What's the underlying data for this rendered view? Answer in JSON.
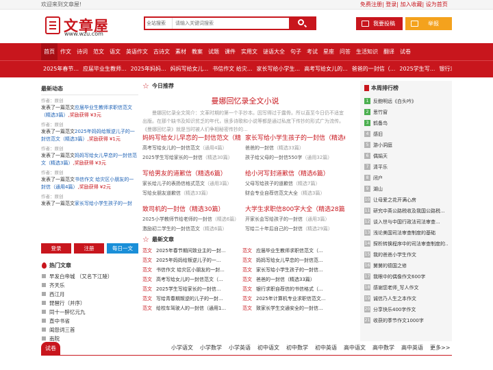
{
  "topbar": {
    "welcome": "欢迎来到文章屋!",
    "links": "免费注册| 登录| 加入收藏| 设为首页"
  },
  "logo": {
    "name": "文章屋",
    "url": "www.wzu.com"
  },
  "search": {
    "scope": "全站搜索",
    "placeholder": "请输入关键词搜索"
  },
  "header_buttons": {
    "submit": "我要投稿",
    "report": "举报"
  },
  "nav": [
    "首页",
    "作文",
    "诗词",
    "范文",
    "语文",
    "英语作文",
    "古诗文",
    "素材",
    "教案",
    "试题",
    "课件",
    "实用文",
    "谜语大全",
    "句子",
    "考试",
    "星座",
    "问答",
    "生活知识",
    "翻译",
    "试卷"
  ],
  "subnav": [
    "2025年春节...",
    "应届毕业生教师...",
    "2025年妈妈...",
    "妈妈写给女儿...",
    "书信作文 给灾...",
    "家长写给小学生...",
    "高考写给女儿的...",
    "爸爸的一封信（...",
    "2025学生写...",
    "银行求职"
  ],
  "left": {
    "title": "最新动态",
    "items": [
      {
        "who": "作者：原创",
        "pre": "发表了一篇范文",
        "link": "应届毕业生教师求职信范文（精选3篇）",
        "reward": ",奖励获得 ¥3元"
      },
      {
        "who": "作者：原创",
        "pre": "发表了一篇范文",
        "link": "2025年妈妈给叛逆儿子的一封信范文（精选3篇）",
        "reward": ",奖励获得 ¥1元"
      },
      {
        "who": "作者：原创",
        "pre": "发表了一篇范文",
        "link": "妈妈写给女儿早恋的一封信范文（精选3篇）",
        "reward": ",奖励获得 ¥3元"
      },
      {
        "who": "作者：原创",
        "pre": "发表了一篇范文",
        "link": "书信作文 给灾区小朋友的一封信（通用4篇）",
        "reward": ",奖励获得 ¥2元"
      },
      {
        "who": "作者：原创",
        "pre": "发表了一篇范文",
        "link": "家长写给小学生孩子的一封",
        "reward": ""
      }
    ],
    "buttons": {
      "login": "登录",
      "register": "注册",
      "daily": "每日一文"
    },
    "hot_title": "热门文章",
    "hot": [
      "早发白帝城 （又名下江陵）",
      "齐天乐",
      "西江月",
      "琵琶行（并序）",
      "同十一醉忆元九",
      "直中书省",
      "闺怨词三首",
      "南院"
    ]
  },
  "mid": {
    "title": "今日推荐",
    "feature_title": "曼娜回忆录全文小说",
    "feature_summary": "曼娜回忆录全文简介：文革时期的第一个手抄本。因写得过于露骨。所以直至今日仍不适宜出版。在那个缺书及知识贫乏的年代，很多诗歌和小说等都是通过私底下传抄的形式广为流传。《曼娜回忆录》就是当时被人们争相秘密传抄的...",
    "groups": [
      {
        "head": "妈妈写给女儿早恋的一封信范文（精",
        "lines": [
          [
            "高考写给女儿的一封信范文",
            "（通用4篇）"
          ],
          [
            "2025学生写给家长的一封信",
            "（精选30篇）"
          ]
        ]
      },
      {
        "head": "家长写给小学生孩子的一封信（精选6",
        "lines": [
          [
            "爸爸的一封信",
            "（精选33篇）"
          ],
          [
            "孩子给父母的一封信550字",
            "（通用32篇）"
          ]
        ]
      },
      {
        "head": "写给男友的道歉信（精选6篇）",
        "lines": [
          [
            "家长给儿子的表扬信格式范文",
            "（通用3篇）"
          ],
          [
            "写给女朋友道歉信",
            "（精选33篇）"
          ]
        ]
      },
      {
        "head": "给小河写封道歉信（精选6篇）",
        "lines": [
          [
            "父母写给孩子的道歉信",
            "（精选7篇）"
          ],
          [
            "财会专业自荐信范文大全",
            "（精选3篇）"
          ]
        ]
      },
      {
        "head": "致司机的一封信（精选30篇）",
        "lines": [
          [
            "2025小学教师节给老师的一封信",
            "（精选6篇）"
          ],
          [
            "激励初二学生的一封信范文",
            "（精选6篇）"
          ]
        ]
      },
      {
        "head": "大学生求职信800字大全（精选28篇）",
        "lines": [
          [
            "开家长会写给孩子的一封信",
            "（通用3篇）"
          ],
          [
            "写给二十年后自己的一封信",
            "（精选29篇）"
          ]
        ]
      }
    ],
    "new_title": "最新文章",
    "new_tag": "范文",
    "new_rows": [
      [
        "2025年春节期间致业主的一封...",
        "应届毕业生教师求职信范文（..."
      ],
      [
        "2025年妈妈给叛逆儿子的一...",
        "妈妈写给女儿早恋的一封信范..."
      ],
      [
        "书信作文 给灾区小朋友的一封...",
        "家长写给小学生孩子的一封信..."
      ],
      [
        "高考写给女儿的一封信范文（...",
        "爸爸的一封信（精选33篇）"
      ],
      [
        "2025学生写给家长的一封信...",
        "银行求职自荐信的书信格式（..."
      ],
      [
        "写给青春期叛逆的儿子的一封...",
        "2025年计算机专业求职信范文..."
      ],
      [
        "给校车驾驶人的一封信（通用1...",
        "致家长学生交通安全的一封信..."
      ]
    ]
  },
  "right": {
    "title": "本周排行榜",
    "items": [
      "反鲍明远《白头吟》",
      "思竹窗",
      "鹤备鸟",
      "感旧",
      "游小洞庭",
      "偶娟天",
      "清平乐",
      "闭户",
      "湖山",
      "让母爱之花开满心房",
      "研究中英公路税收及我国公路税...",
      "谈入世与中国行政法司法审查...",
      "浅论美国司法审查制度的基础",
      "探析转换程序中的司法审查制度的...",
      "我的爸爸小学生作文",
      "舅舅的德国之修",
      "我眼中的偶像作文600字",
      "感谢您老师_写人作文",
      "诚信乃人生之本作文",
      "分享快乐400字作文",
      "收获的季节作文1000字"
    ]
  },
  "tabs": {
    "head": "试卷",
    "options": [
      "小学语文",
      "小学数学",
      "小学英语",
      "初中语文",
      "初中数学",
      "初中英语",
      "高中语文",
      "高中数学",
      "高中英语",
      "更多>>"
    ]
  },
  "colors": {
    "brand": "#c8161d",
    "link": "#1a5fb4",
    "accent": "#f4a21d",
    "daily": "#1a8fd8"
  }
}
